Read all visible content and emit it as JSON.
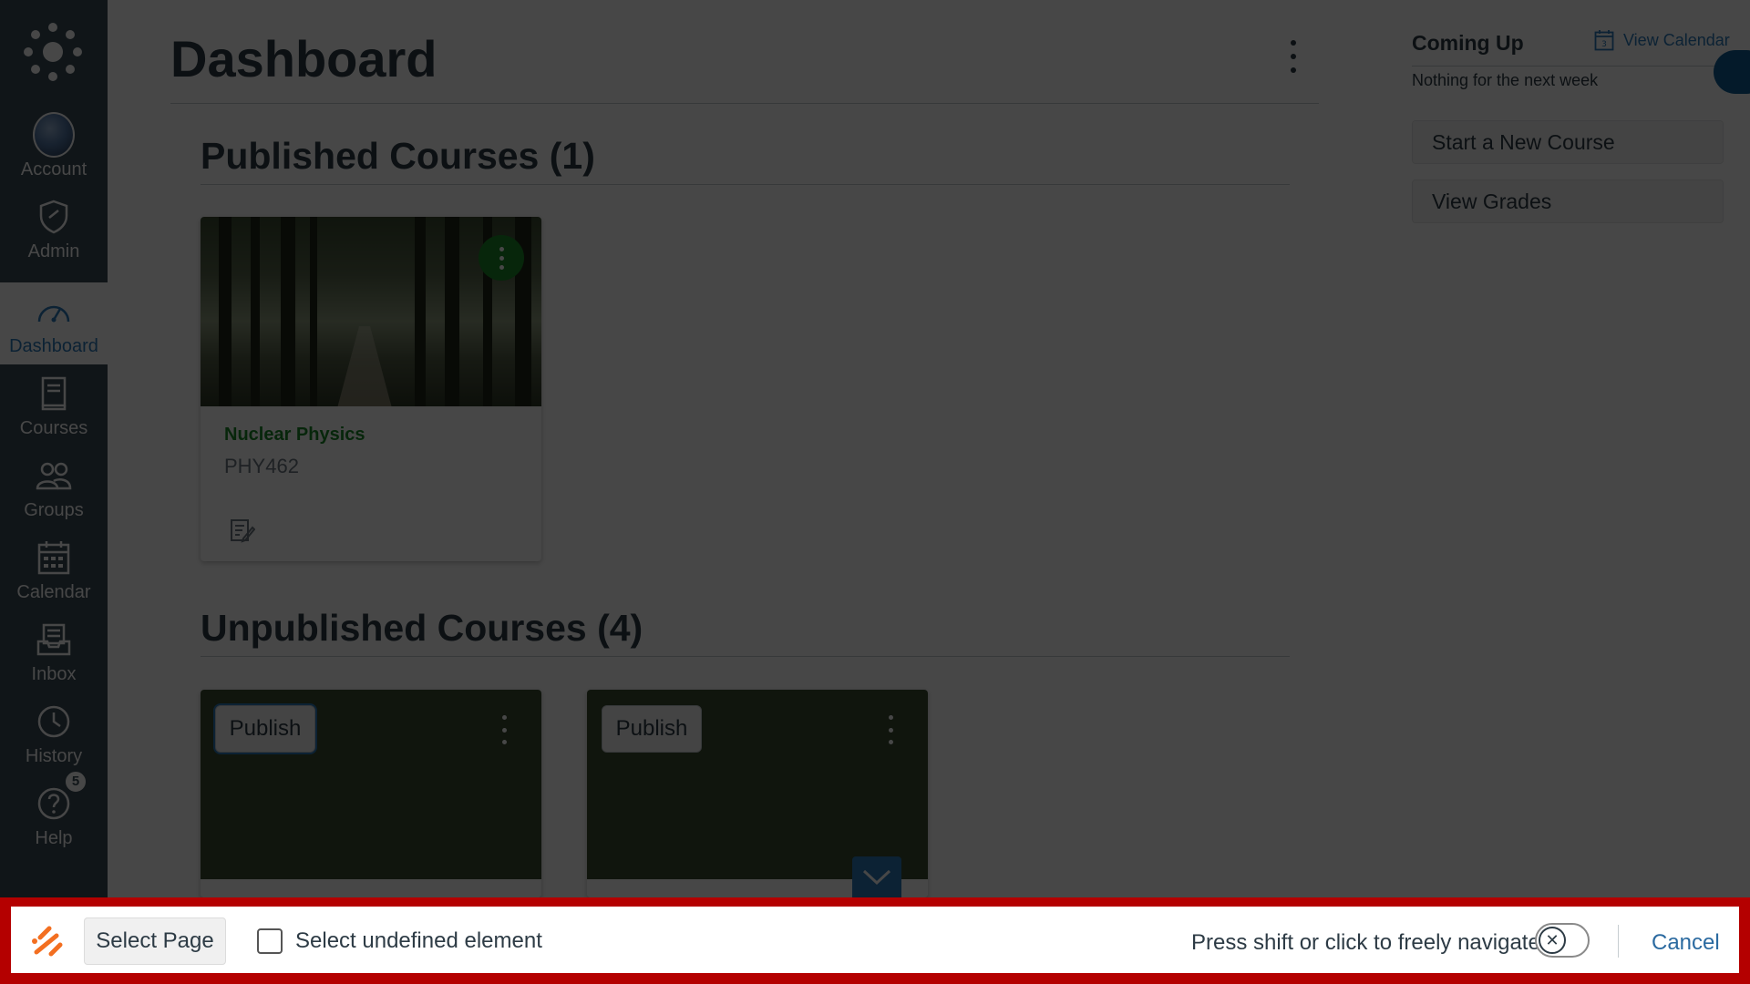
{
  "nav": {
    "items": [
      {
        "label": "Account",
        "icon": "account-avatar"
      },
      {
        "label": "Admin",
        "icon": "shield-icon"
      },
      {
        "label": "Dashboard",
        "icon": "speedometer-icon"
      },
      {
        "label": "Courses",
        "icon": "book-icon"
      },
      {
        "label": "Groups",
        "icon": "people-icon"
      },
      {
        "label": "Calendar",
        "icon": "calendar-icon"
      },
      {
        "label": "Inbox",
        "icon": "inbox-icon"
      },
      {
        "label": "History",
        "icon": "clock-icon"
      },
      {
        "label": "Help",
        "icon": "help-icon",
        "badge": "5"
      }
    ]
  },
  "main": {
    "title": "Dashboard",
    "published": {
      "title": "Published Courses (1)",
      "courses": [
        {
          "name": "Nuclear Physics",
          "code": "PHY462"
        }
      ]
    },
    "unpublished": {
      "title": "Unpublished Courses (4)",
      "publish_label": "Publish"
    }
  },
  "sidebar": {
    "coming_up_title": "Coming Up",
    "view_calendar": "View Calendar",
    "calendar_icon_day": "3",
    "empty_text": "Nothing for the next week",
    "start_course": "Start a New Course",
    "view_grades": "View Grades"
  },
  "toolbar": {
    "select_page": "Select Page",
    "select_undefined": "Select undefined element",
    "navigate_hint": "Press shift or click to freely navigate",
    "cancel": "Cancel"
  },
  "colors": {
    "nav_bg": "#394b58",
    "accent": "#2b7abc",
    "course_green": "#1c8a2a",
    "toolbar_border": "#b40000"
  }
}
